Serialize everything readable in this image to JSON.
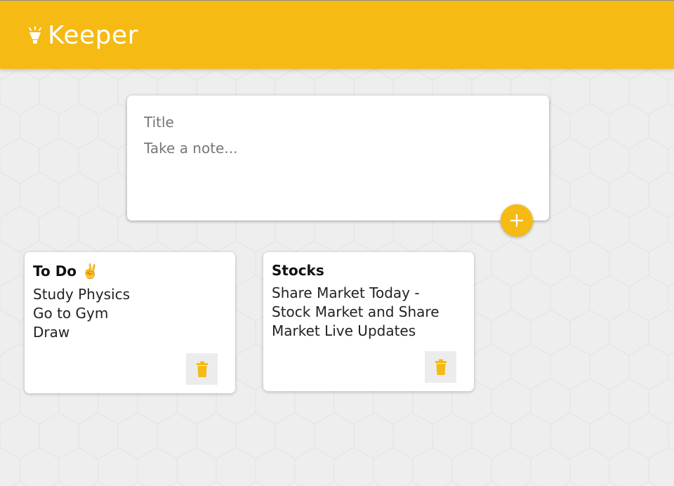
{
  "app": {
    "name": "Keeper",
    "colors": {
      "accent": "#f5ba13",
      "background": "#eeeeee",
      "card": "#ffffff"
    },
    "logo_icon": "lightbulb-icon"
  },
  "create_note": {
    "title_placeholder": "Title",
    "content_placeholder": "Take a note...",
    "add_icon": "plus-icon"
  },
  "notes": [
    {
      "title": "To Do ✌️",
      "content": "Study Physics\nGo to Gym\nDraw",
      "delete_icon": "trash-icon"
    },
    {
      "title": "Stocks",
      "content": "Share Market Today -\nStock Market and Share\nMarket Live Updates",
      "delete_icon": "trash-icon"
    }
  ]
}
